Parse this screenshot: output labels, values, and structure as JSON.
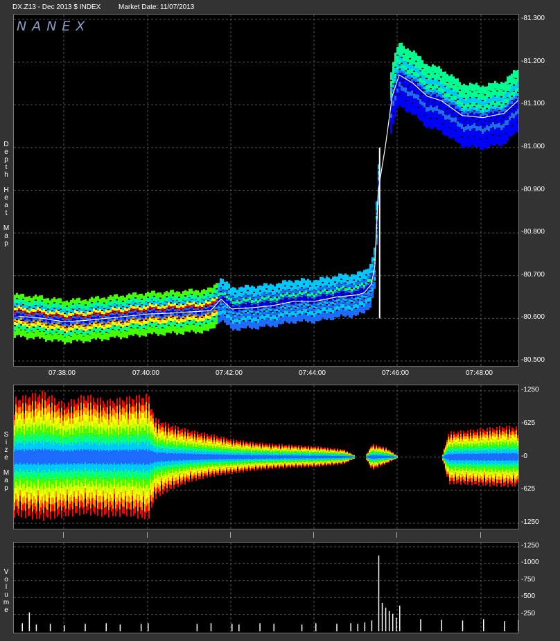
{
  "header": {
    "symbol": "DX.Z13 - Dec 2013 $ INDEX",
    "market_date": "Market Date: 11/07/2013"
  },
  "logo_text": "NANEX",
  "panels": {
    "heatmap_label": [
      "D",
      "e",
      "p",
      "t",
      "h",
      "",
      "H",
      "e",
      "a",
      "t",
      "",
      "M",
      "a",
      "p"
    ],
    "size_label": [
      "S",
      "i",
      "z",
      "e",
      "",
      "M",
      "a",
      "p"
    ],
    "volume_label": [
      "V",
      "o",
      "l",
      "u",
      "m",
      "e"
    ]
  },
  "colors": {
    "background": "#333333",
    "plot_bg": "#000000",
    "grid": "#555555",
    "heat": [
      "#0000ff",
      "#1e6bff",
      "#00c8ff",
      "#00ff90",
      "#44ff00",
      "#c8ff00",
      "#ffff00",
      "#ff9000",
      "#ff0000"
    ]
  },
  "chart_data": [
    {
      "type": "heatmap",
      "title": "Depth Heat Map",
      "x_ticks": [
        "07:38:00",
        "07:40:00",
        "07:42:00",
        "07:44:00",
        "07:46:00",
        "07:48:00"
      ],
      "y_ticks": [
        "81.300",
        "81.200",
        "81.100",
        "81.000",
        "80.900",
        "80.800",
        "80.700",
        "80.600",
        "80.500"
      ],
      "ylim": [
        80.5,
        81.3
      ],
      "price_path": {
        "x": [
          "07:36:55",
          "07:37:30",
          "07:38:00",
          "07:38:30",
          "07:39:00",
          "07:39:30",
          "07:40:00",
          "07:40:30",
          "07:41:00",
          "07:41:30",
          "07:41:45",
          "07:42:00",
          "07:42:30",
          "07:43:00",
          "07:43:30",
          "07:44:00",
          "07:44:30",
          "07:45:00",
          "07:45:10",
          "07:45:20",
          "07:45:25",
          "07:45:30",
          "07:45:40",
          "07:45:50",
          "07:46:00",
          "07:46:20",
          "07:46:40",
          "07:47:00",
          "07:47:30",
          "07:48:00",
          "07:48:30",
          "07:48:50"
        ],
        "y": [
          80.605,
          80.6,
          80.592,
          80.595,
          80.6,
          80.605,
          80.61,
          80.612,
          80.615,
          80.618,
          80.645,
          80.622,
          80.625,
          80.63,
          80.64,
          80.64,
          80.65,
          80.655,
          80.66,
          80.68,
          80.72,
          80.9,
          81.0,
          81.12,
          81.17,
          81.15,
          81.12,
          81.11,
          81.075,
          81.07,
          81.08,
          81.11
        ]
      }
    },
    {
      "type": "heatmap",
      "title": "Size Map",
      "x_ticks": [],
      "y_ticks": [
        "1250",
        "625",
        "0",
        "625",
        "1250"
      ],
      "ylim": [
        -1250,
        1250
      ],
      "size_envelope": {
        "x": [
          "07:36:55",
          "07:37:30",
          "07:38:00",
          "07:38:30",
          "07:39:00",
          "07:39:30",
          "07:40:00",
          "07:40:10",
          "07:40:30",
          "07:41:00",
          "07:41:30",
          "07:42:00",
          "07:42:30",
          "07:43:00",
          "07:43:30",
          "07:44:00",
          "07:44:40",
          "07:45:00",
          "07:45:10",
          "07:45:20",
          "07:45:40",
          "07:46:00",
          "07:47:00",
          "07:47:10",
          "07:47:30",
          "07:48:00",
          "07:48:30",
          "07:49:00"
        ],
        "ask_size": [
          1000,
          1100,
          900,
          1050,
          950,
          1000,
          1050,
          650,
          550,
          450,
          380,
          300,
          250,
          220,
          200,
          180,
          130,
          0,
          0,
          220,
          160,
          0,
          0,
          420,
          440,
          480,
          520,
          500
        ],
        "bid_size": [
          1000,
          1050,
          1000,
          950,
          1000,
          980,
          1050,
          700,
          560,
          420,
          330,
          280,
          230,
          200,
          180,
          170,
          120,
          0,
          0,
          220,
          120,
          0,
          0,
          450,
          460,
          480,
          500,
          480
        ]
      }
    },
    {
      "type": "bar",
      "title": "Volume",
      "y_ticks": [
        "1250",
        "1000",
        "750",
        "500",
        "250"
      ],
      "ylim": [
        0,
        1250
      ],
      "bars": {
        "x": [
          "07:37:00",
          "07:37:10",
          "07:37:20",
          "07:37:40",
          "07:38:00",
          "07:38:30",
          "07:39:00",
          "07:39:20",
          "07:39:50",
          "07:40:00",
          "07:41:10",
          "07:41:30",
          "07:42:00",
          "07:42:10",
          "07:42:40",
          "07:43:00",
          "07:43:40",
          "07:44:00",
          "07:44:30",
          "07:44:50",
          "07:45:00",
          "07:45:10",
          "07:45:20",
          "07:45:30",
          "07:45:35",
          "07:45:40",
          "07:45:45",
          "07:45:50",
          "07:45:55",
          "07:46:00",
          "07:46:30",
          "07:47:00",
          "07:47:30",
          "07:48:00",
          "07:48:30",
          "07:48:50"
        ],
        "values": [
          120,
          280,
          100,
          110,
          90,
          110,
          120,
          100,
          110,
          120,
          110,
          120,
          110,
          100,
          120,
          110,
          100,
          120,
          110,
          120,
          110,
          130,
          160,
          1120,
          420,
          350,
          300,
          260,
          200,
          380,
          180,
          170,
          160,
          180,
          150,
          170
        ]
      }
    }
  ]
}
